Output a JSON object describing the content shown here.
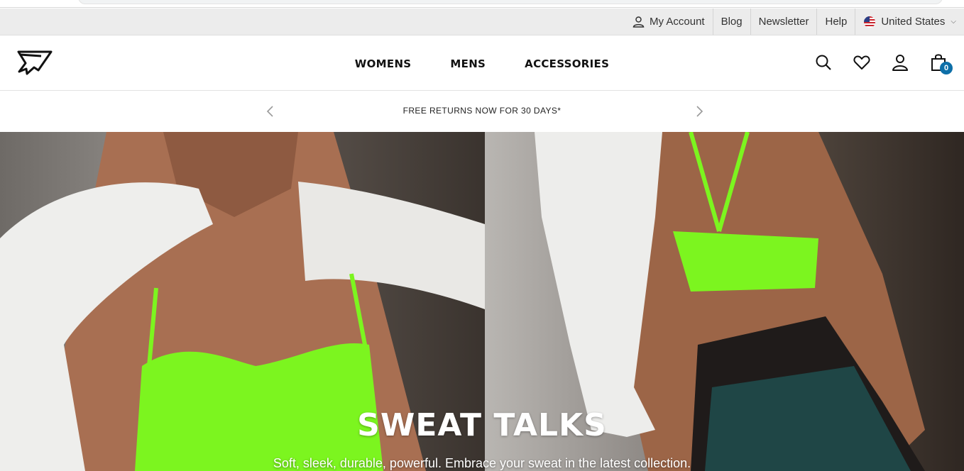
{
  "utility_bar": {
    "account": "My Account",
    "blog": "Blog",
    "newsletter": "Newsletter",
    "help": "Help",
    "region": "United States"
  },
  "header": {
    "logo_icon": "gymshark-shark-logo",
    "nav": [
      "WOMENS",
      "MENS",
      "ACCESSORIES"
    ],
    "icons": [
      "search-icon",
      "heart-icon",
      "user-icon",
      "bag-icon"
    ],
    "cart_count": "0",
    "badge_color": "#0d6fa8"
  },
  "promo": {
    "text": "FREE RETURNS NOW FOR 30 DAYS*"
  },
  "hero": {
    "title": "SWEAT TALKS",
    "subtitle": "Soft, sleek, durable, powerful. Embrace your sweat in the latest collection.",
    "accent_color": "#7cf51f"
  }
}
